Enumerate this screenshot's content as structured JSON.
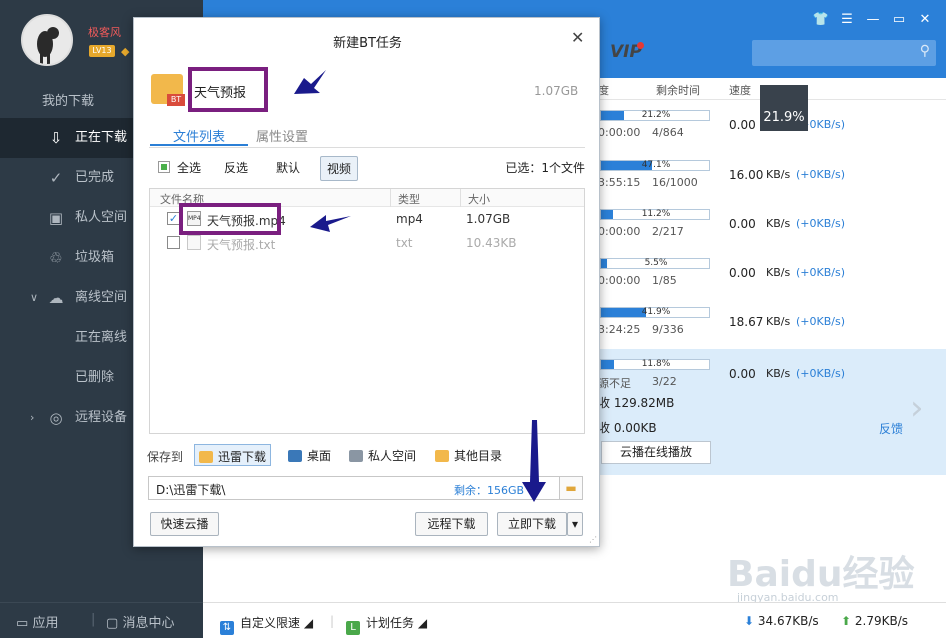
{
  "sidebar": {
    "username": "极客风",
    "level": "LV13",
    "nav": [
      {
        "label": "我的下载"
      },
      {
        "label": "正在下载"
      },
      {
        "label": "已完成"
      },
      {
        "label": "私人空间"
      },
      {
        "label": "垃圾箱"
      },
      {
        "label": "离线空间"
      },
      {
        "label": "正在离线"
      },
      {
        "label": "已删除"
      },
      {
        "label": "远程设备"
      }
    ],
    "bottom": {
      "apps": "应用",
      "messages": "消息中心"
    }
  },
  "topbar": {
    "vip": "VIP"
  },
  "columns": {
    "progress": "度",
    "remaining": "剩余时间",
    "speed": "速度"
  },
  "tasks": [
    {
      "pct": "21.2%",
      "fill": 0.212,
      "time": "0:00:00",
      "count": "4/864",
      "speed": "0.00",
      "unit": "",
      "extra": "(+0KB/s)"
    },
    {
      "pct": "47.1%",
      "fill": 0.471,
      "time": "3:55:15",
      "count": "16/1000",
      "speed": "16.00",
      "unit": "KB/s",
      "extra": "(+0KB/s)"
    },
    {
      "pct": "11.2%",
      "fill": 0.112,
      "time": "0:00:00",
      "count": "2/217",
      "speed": "0.00",
      "unit": "KB/s",
      "extra": "(+0KB/s)"
    },
    {
      "pct": "5.5%",
      "fill": 0.055,
      "time": "0:00:00",
      "count": "1/85",
      "speed": "0.00",
      "unit": "KB/s",
      "extra": "(+0KB/s)"
    },
    {
      "pct": "41.9%",
      "fill": 0.419,
      "time": "3:24:25",
      "count": "9/336",
      "speed": "18.67",
      "unit": "KB/s",
      "extra": "(+0KB/s)"
    }
  ],
  "selected_task": {
    "pct": "11.8%",
    "fill": 0.118,
    "time": "源不足",
    "count": "3/22",
    "speed": "0.00",
    "unit": "KB/s",
    "extra": "(+0KB/s)",
    "received": "收 129.82MB",
    "received2": "收 0.00KB",
    "cloud_play": "云播在线播放",
    "feedback": "反馈"
  },
  "overlay_speed": "21.9%",
  "statusbar": {
    "speed_limit": "自定义限速",
    "schedule": "计划任务",
    "down": "34.67KB/s",
    "up": "2.79KB/s"
  },
  "watermark": {
    "text": "Baidu经验",
    "url": "jingyan.baidu.com"
  },
  "dialog": {
    "title": "新建BT任务",
    "task_name": "天气预报",
    "folder_badge": "BT",
    "task_size": "1.07GB",
    "tabs": {
      "files": "文件列表",
      "props": "属性设置"
    },
    "filters": {
      "all": "全选",
      "invert": "反选",
      "default": "默认",
      "video": "视频"
    },
    "selected_count": "已选：1个文件",
    "list_head": {
      "name": "文件名称",
      "type": "类型",
      "size": "大小"
    },
    "files": [
      {
        "check": "✓",
        "icon": "MP4",
        "name": "天气预报.mp4",
        "type": "mp4",
        "size": "1.07GB"
      },
      {
        "check": "",
        "icon": "",
        "name": "天气预报.txt",
        "type": "txt",
        "size": "10.43KB"
      }
    ],
    "save_to": "保存到",
    "locations": {
      "xunlei": "迅雷下载",
      "desktop": "桌面",
      "private": "私人空间",
      "other": "其他目录"
    },
    "path": "D:\\迅雷下载\\",
    "free_space": "剩余：156GB",
    "buttons": {
      "quick_cloud": "快速云播",
      "remote": "远程下载",
      "download_now": "立即下载"
    }
  },
  "colors": {
    "accent": "#2b80d8",
    "sidebar": "#2d3a46",
    "highlight": "#7a1f7f",
    "arrow": "#1a1a8c"
  }
}
